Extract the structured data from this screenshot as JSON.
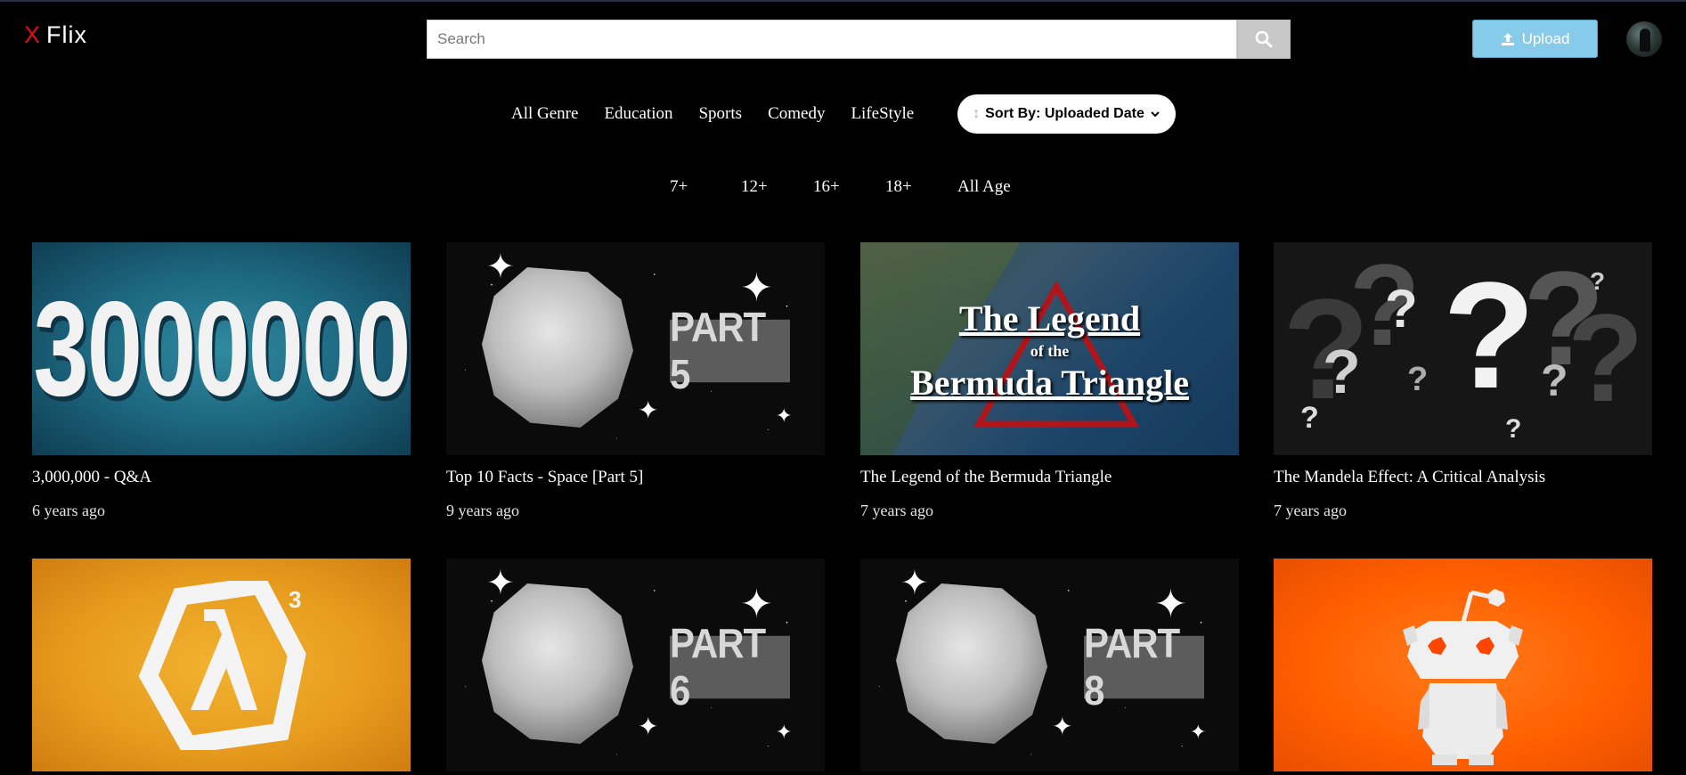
{
  "app": {
    "logo_mark": "X",
    "logo_text": "Flix"
  },
  "search": {
    "placeholder": "Search",
    "value": ""
  },
  "upload": {
    "label": "Upload"
  },
  "genres": [
    "All Genre",
    "Education",
    "Sports",
    "Comedy",
    "LifeStyle"
  ],
  "sort": {
    "label": "Sort By: Uploaded Date"
  },
  "ages": [
    "7+",
    "12+",
    "16+",
    "18+",
    "All Age"
  ],
  "videos": [
    {
      "title": "3,000,000 - Q&A",
      "date": "6 years ago",
      "thumb_text": "3000000"
    },
    {
      "title": "Top 10 Facts - Space [Part 5]",
      "date": "9 years ago",
      "thumb_text": "PART 5"
    },
    {
      "title": "The Legend of the Bermuda Triangle",
      "date": "7 years ago",
      "thumb_line1": "The Legend",
      "thumb_line2": "of the",
      "thumb_line3": "Bermuda Triangle"
    },
    {
      "title": "The Mandela Effect: A Critical Analysis",
      "date": "7 years ago"
    },
    {
      "title": "",
      "date": ""
    },
    {
      "title": "",
      "date": "",
      "thumb_text": "PART 6"
    },
    {
      "title": "",
      "date": "",
      "thumb_text": "PART 8"
    },
    {
      "title": "",
      "date": ""
    }
  ],
  "colors": {
    "background": "#000000",
    "brand": "#e50914",
    "upload_button": "#86cbe9"
  }
}
